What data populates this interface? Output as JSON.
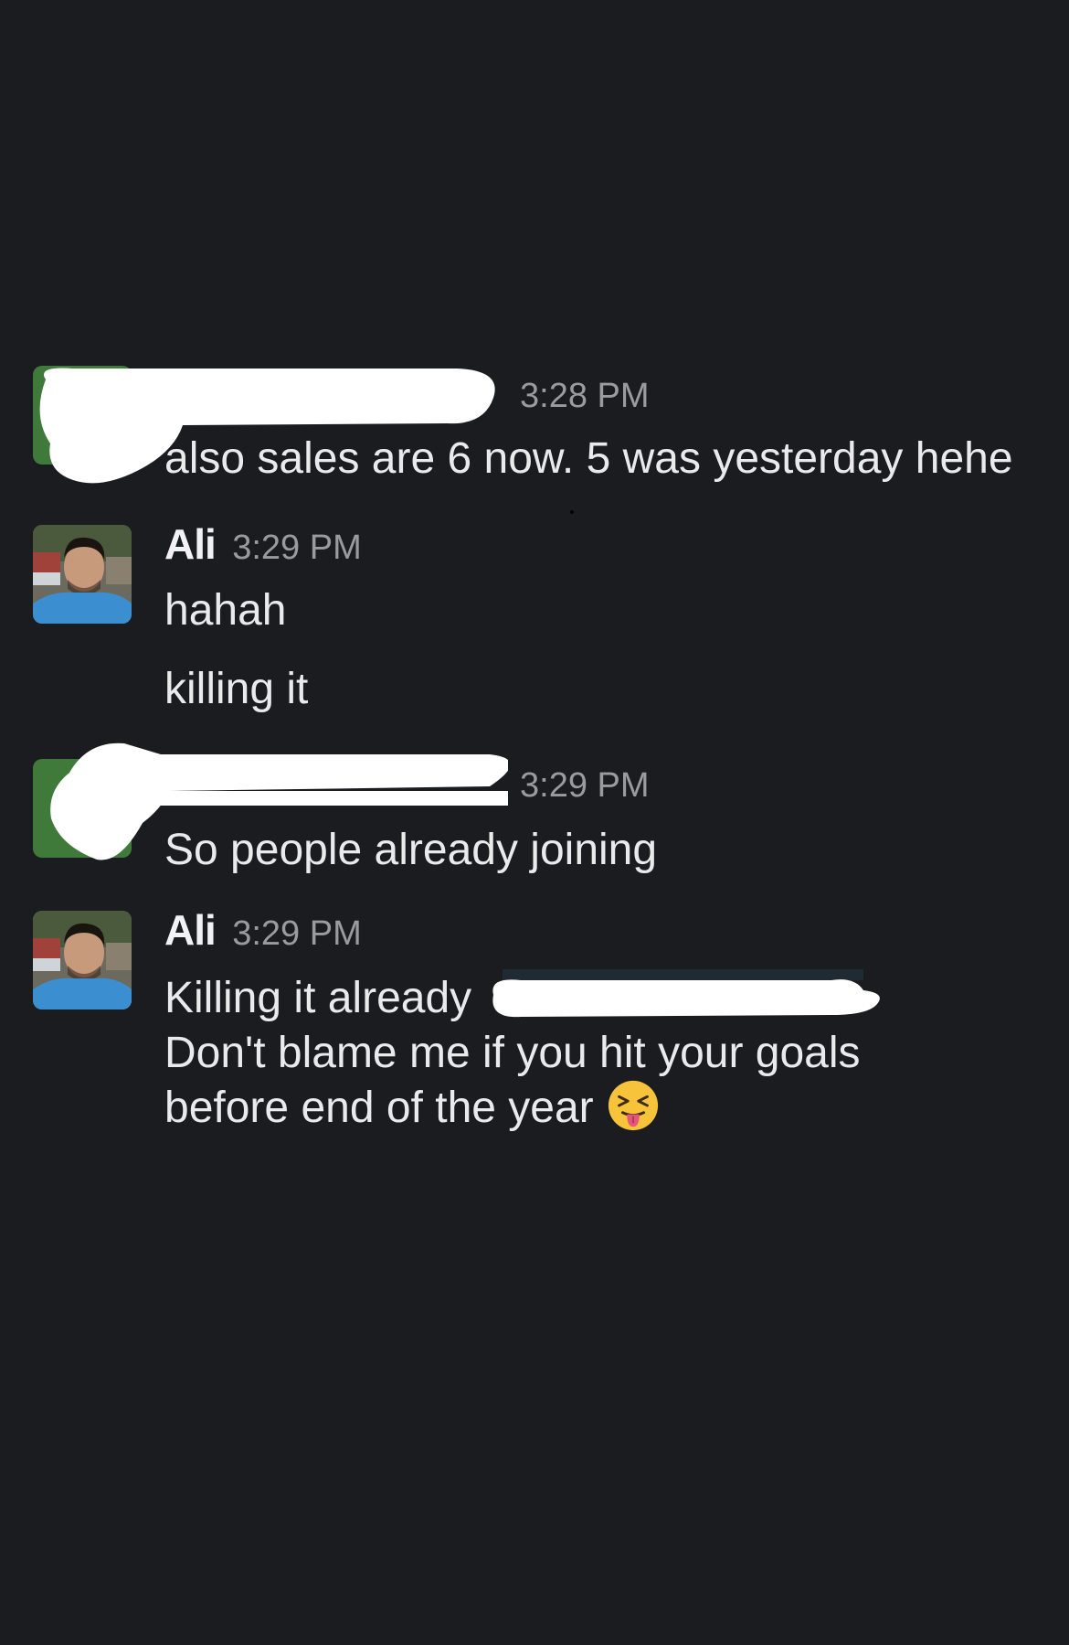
{
  "messages": [
    {
      "sender": "",
      "time": "3:28 PM",
      "lines": [
        "also sales are 6 now. 5 was yesterday hehe"
      ]
    },
    {
      "sender": "Ali",
      "time": "3:29 PM",
      "lines": [
        "hahah",
        "killing it"
      ]
    },
    {
      "sender": "",
      "time": "3:29 PM",
      "lines": [
        "So people already joining"
      ]
    },
    {
      "sender": "Ali",
      "time": "3:29 PM",
      "lines": [
        "Killing it already",
        "Don't blame me if you hit your goals",
        "before end of the year"
      ],
      "emoji": "tongue-out-squint-face-icon"
    }
  ],
  "colors": {
    "background": "#1b1c20",
    "text": "#eaeaec",
    "timestamp": "#9a9ba0",
    "redaction": "#ffffff"
  }
}
